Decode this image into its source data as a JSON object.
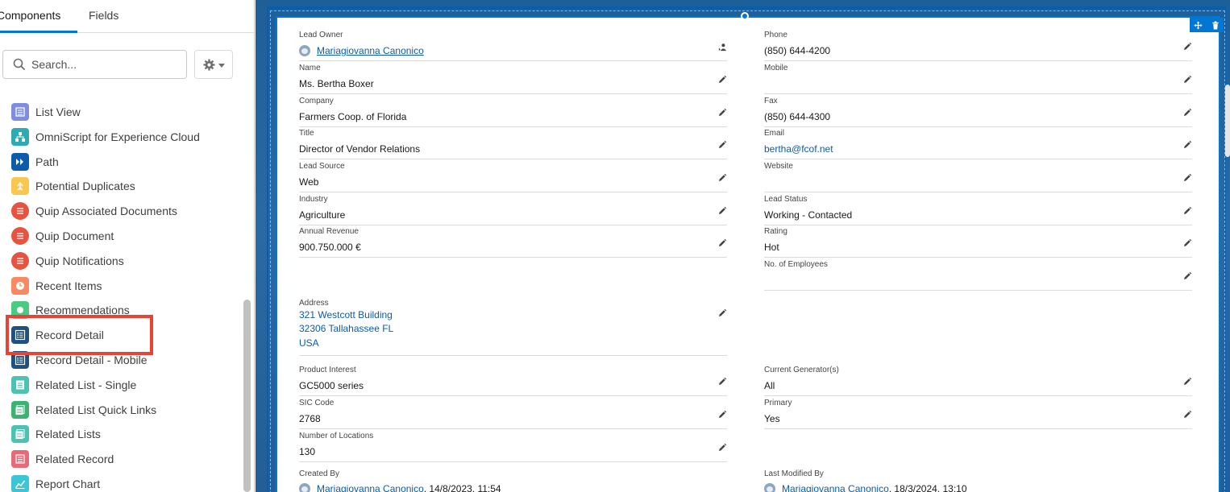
{
  "tabs": {
    "components": "Components",
    "fields": "Fields"
  },
  "search": {
    "placeholder": "Search..."
  },
  "components": [
    {
      "label": "List View",
      "icon": "list-view-icon",
      "color": "#7f8de1"
    },
    {
      "label": "OmniScript for Experience Cloud",
      "icon": "hierarchy-icon",
      "color": "#2dabb3"
    },
    {
      "label": "Path",
      "icon": "path-chevron-icon",
      "color": "#0b5cab"
    },
    {
      "label": "Potential Duplicates",
      "icon": "duplicates-icon",
      "color": "#f9c74f"
    },
    {
      "label": "Quip Associated Documents",
      "icon": "quip-icon",
      "color": "#e8533f"
    },
    {
      "label": "Quip Document",
      "icon": "quip-icon",
      "color": "#e8533f"
    },
    {
      "label": "Quip Notifications",
      "icon": "quip-icon",
      "color": "#e8533f"
    },
    {
      "label": "Recent Items",
      "icon": "clock-icon",
      "color": "#f88962"
    },
    {
      "label": "Recommendations",
      "icon": "recommendation-icon",
      "color": "#4bca81"
    },
    {
      "label": "Record Detail",
      "icon": "record-detail-icon",
      "color": "#1e5081"
    },
    {
      "label": "Record Detail - Mobile",
      "icon": "record-detail-icon",
      "color": "#1e5081"
    },
    {
      "label": "Related List - Single",
      "icon": "related-list-icon",
      "color": "#4bc2b2"
    },
    {
      "label": "Related List Quick Links",
      "icon": "related-list-icon",
      "color": "#3cb371"
    },
    {
      "label": "Related Lists",
      "icon": "related-lists-icon",
      "color": "#4bc2b2"
    },
    {
      "label": "Related Record",
      "icon": "related-record-icon",
      "color": "#e66a77"
    },
    {
      "label": "Report Chart",
      "icon": "chart-icon",
      "color": "#3cc5d6"
    }
  ],
  "record": {
    "left": [
      {
        "label": "Lead Owner",
        "value": "Mariagiovanna Canonico"
      },
      {
        "label": "Name",
        "value": "Ms. Bertha Boxer"
      },
      {
        "label": "Company",
        "value": "Farmers Coop. of Florida"
      },
      {
        "label": "Title",
        "value": "Director of Vendor Relations"
      },
      {
        "label": "Lead Source",
        "value": "Web"
      },
      {
        "label": "Industry",
        "value": "Agriculture"
      },
      {
        "label": "Annual Revenue",
        "value": "900.750.000 €"
      }
    ],
    "right": [
      {
        "label": "Phone",
        "value": "(850) 644-4200"
      },
      {
        "label": "Mobile",
        "value": ""
      },
      {
        "label": "Fax",
        "value": "(850) 644-4300"
      },
      {
        "label": "Email",
        "value": "bertha@fcof.net"
      },
      {
        "label": "Website",
        "value": ""
      },
      {
        "label": "Lead Status",
        "value": "Working - Contacted"
      },
      {
        "label": "Rating",
        "value": "Hot"
      },
      {
        "label": "No. of Employees",
        "value": ""
      }
    ],
    "address": {
      "label": "Address",
      "line1": "321 Westcott Building",
      "line2": "32306 Tallahassee FL",
      "line3": "USA"
    },
    "lower_left": [
      {
        "label": "Product Interest",
        "value": "GC5000 series"
      },
      {
        "label": "SIC Code",
        "value": "2768"
      },
      {
        "label": "Number of Locations",
        "value": "130"
      }
    ],
    "lower_right": [
      {
        "label": "Current Generator(s)",
        "value": "All"
      },
      {
        "label": "Primary",
        "value": "Yes"
      }
    ],
    "created_by": {
      "label": "Created By",
      "user": "Mariagiovanna Canonico",
      "date": ", 14/8/2023, 11:54"
    },
    "modified_by": {
      "label": "Last Modified By",
      "user": "Mariagiovanna Canonico",
      "date": ", 18/3/2024, 13:10"
    }
  }
}
